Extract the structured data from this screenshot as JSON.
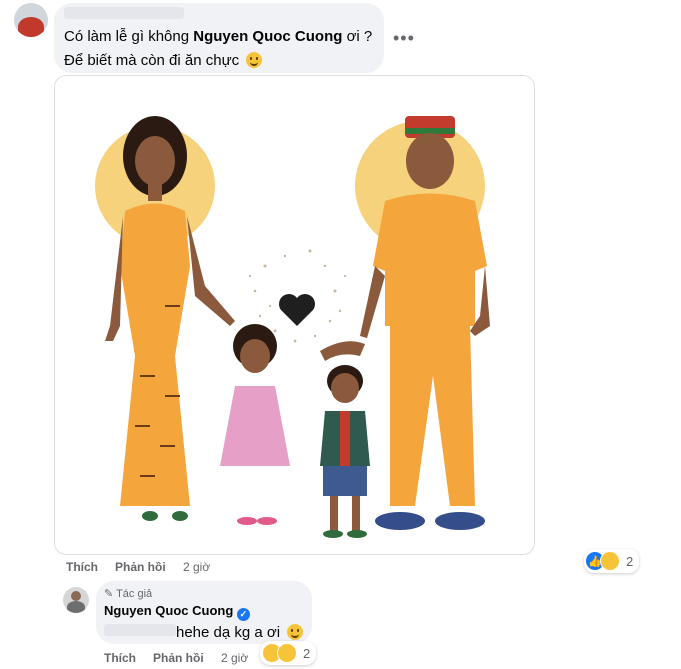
{
  "comment1": {
    "text_before": "Có làm lễ gì không ",
    "mention": "Nguyen Quoc Cuong",
    "text_after": " ơi ?",
    "line2": "Để biết mà còn đi ăn chực",
    "more_label": "•••",
    "actions": {
      "like": "Thích",
      "reply": "Phản hồi",
      "time": "2 giờ"
    },
    "reaction_count": "2"
  },
  "reply1": {
    "author_badge": "Tác giả",
    "author": "Nguyen Quoc Cuong",
    "text": "hehe dạ kg a ơi",
    "actions": {
      "like": "Thích",
      "reply": "Phản hồi",
      "time": "2 giờ"
    },
    "reaction_count": "2"
  },
  "colors": {
    "accent": "#1877f2",
    "bubble": "#f0f2f5",
    "muted": "#65676b",
    "gold": "#f5d27b",
    "orange": "#f4a63d"
  }
}
